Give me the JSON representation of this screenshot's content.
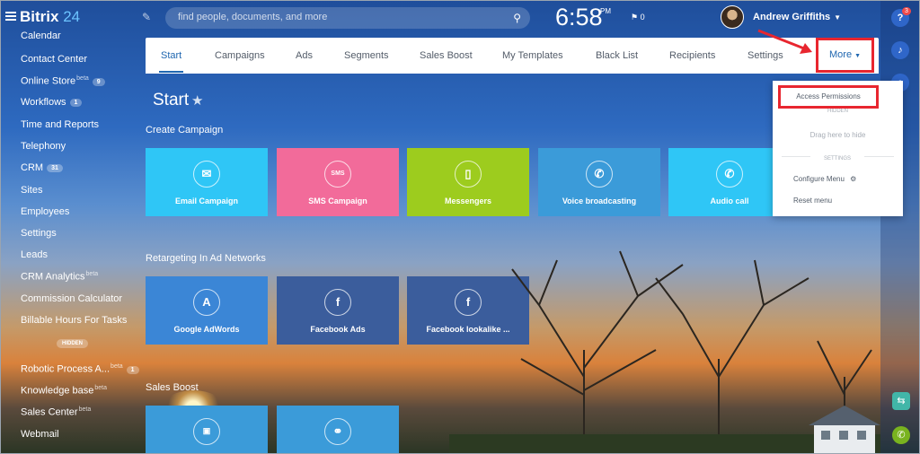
{
  "header": {
    "app_name": "Bitrix",
    "app_version": "24",
    "search_placeholder": "find people, documents, and more",
    "clock": "6:58",
    "ampm": "PM",
    "flag_count": "0",
    "user_name": "Andrew Griffiths",
    "help_badge": "3"
  },
  "sidebar": {
    "items": [
      {
        "label": "Calendar"
      },
      {
        "label": "Contact Center"
      },
      {
        "label": "Online Store",
        "sup": "beta",
        "badge": "9"
      },
      {
        "label": "Workflows",
        "badge": "1"
      },
      {
        "label": "Time and Reports"
      },
      {
        "label": "Telephony"
      },
      {
        "label": "CRM",
        "badge": "31"
      },
      {
        "label": "Sites"
      },
      {
        "label": "Employees"
      },
      {
        "label": "Settings"
      },
      {
        "label": "Leads"
      },
      {
        "label": "CRM Analytics",
        "sup": "beta"
      },
      {
        "label": "Commission Calculator"
      },
      {
        "label": "Billable Hours For Tasks"
      },
      {
        "label": "Robotic Process A...",
        "sup": "beta",
        "badge": "1"
      },
      {
        "label": "Knowledge base",
        "sup": "beta"
      },
      {
        "label": "Sales Center",
        "sup": "beta"
      },
      {
        "label": "Webmail"
      }
    ],
    "hidden_label": "HIDDEN"
  },
  "tabs": {
    "items": [
      "Start",
      "Campaigns",
      "Ads",
      "Segments",
      "Sales Boost",
      "My Templates",
      "Black List",
      "Recipients",
      "Settings"
    ],
    "more_label": "More"
  },
  "dropdown": {
    "access_permissions": "Access Permissions",
    "hidden_heading": "HIDDEN",
    "drag_hint": "Drag here to hide",
    "settings_heading": "SETTINGS",
    "configure_menu": "Configure Menu",
    "reset_menu": "Reset menu"
  },
  "page": {
    "title": "Start",
    "sections": {
      "create": "Create Campaign",
      "retargeting": "Retargeting In Ad Networks",
      "sales_boost": "Sales Boost"
    },
    "create_tiles": [
      {
        "label": "Email Campaign",
        "icon": "envelope-icon",
        "color": "#2fc6f6"
      },
      {
        "label": "SMS Campaign",
        "icon": "sms-icon",
        "color": "#f26b9a"
      },
      {
        "label": "Messengers",
        "icon": "phone-icon",
        "color": "#9dcc1e"
      },
      {
        "label": "Voice broadcasting",
        "icon": "voice-icon",
        "color": "#3b9bd9"
      },
      {
        "label": "Audio call",
        "icon": "audio-call-icon",
        "color": "#2fc6f6"
      }
    ],
    "retargeting_tiles": [
      {
        "label": "Google AdWords",
        "icon": "adwords-icon",
        "color": "#3b86d6"
      },
      {
        "label": "Facebook Ads",
        "icon": "facebook-icon",
        "color": "#3b5d9c"
      },
      {
        "label": "Facebook lookalike ...",
        "icon": "facebook-icon",
        "color": "#3b5d9c"
      }
    ],
    "sales_boost_tiles": [
      {
        "label": "",
        "icon": "ad-icon",
        "color": "#3b9bd9"
      },
      {
        "label": "",
        "icon": "handshake-icon",
        "color": "#3b9bd9"
      }
    ]
  }
}
